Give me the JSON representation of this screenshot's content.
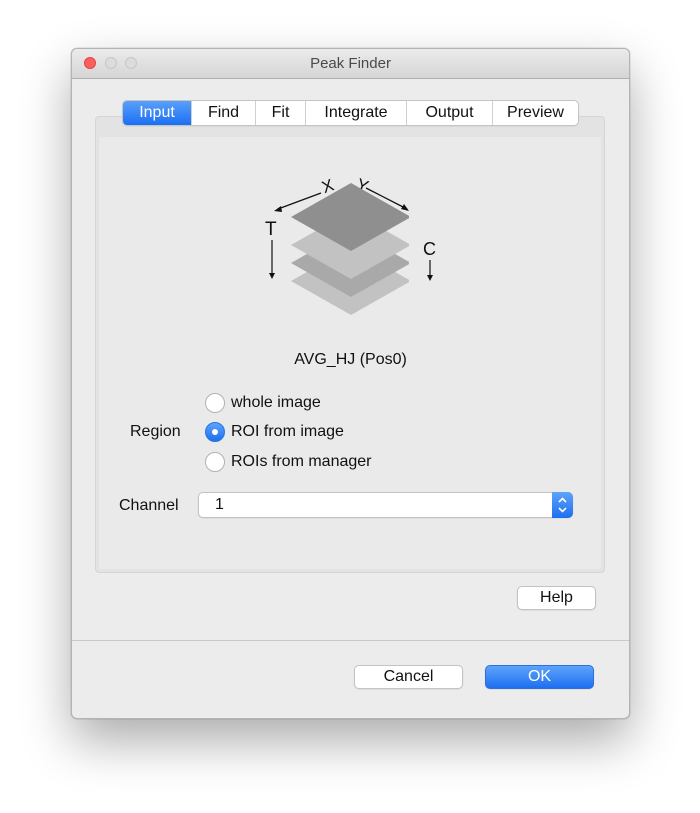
{
  "window": {
    "title": "Peak Finder"
  },
  "tabs": [
    {
      "label": "Input",
      "active": true
    },
    {
      "label": "Find",
      "active": false
    },
    {
      "label": "Fit",
      "active": false
    },
    {
      "label": "Integrate",
      "active": false
    },
    {
      "label": "Output",
      "active": false
    },
    {
      "label": "Preview",
      "active": false
    }
  ],
  "stack_icon": {
    "x_label": "X",
    "y_label": "Y",
    "t_label": "T",
    "c_label": "C"
  },
  "image_name": "AVG_HJ (Pos0)",
  "region": {
    "label": "Region",
    "options": [
      {
        "label": "whole image",
        "selected": false
      },
      {
        "label": "ROI from image",
        "selected": true
      },
      {
        "label": "ROIs from manager",
        "selected": false
      }
    ]
  },
  "channel": {
    "label": "Channel",
    "value": "1"
  },
  "buttons": {
    "help": "Help",
    "cancel": "Cancel",
    "ok": "OK"
  },
  "colors": {
    "accent": "#1a6ff2",
    "close_light": "#fc605c"
  }
}
